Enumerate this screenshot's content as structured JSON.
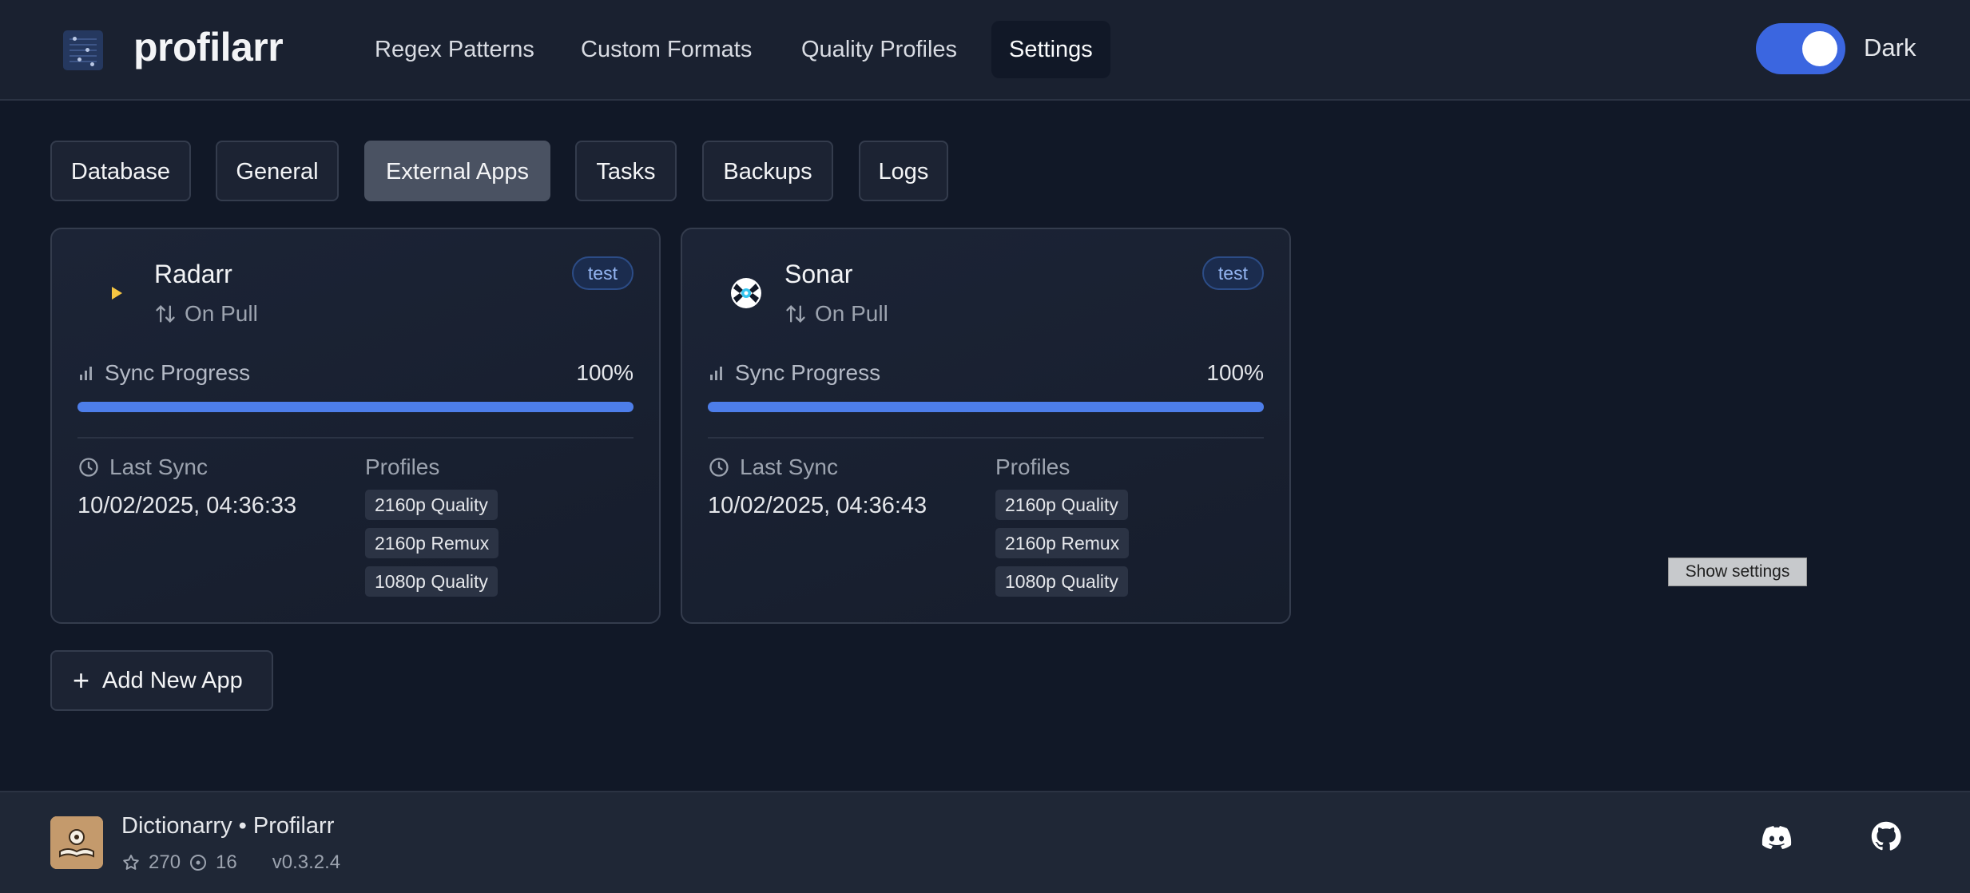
{
  "header": {
    "brand": "profilarr",
    "nav": [
      {
        "label": "Regex Patterns"
      },
      {
        "label": "Custom Formats"
      },
      {
        "label": "Quality Profiles"
      },
      {
        "label": "Settings"
      }
    ],
    "theme_label": "Dark",
    "theme_on": true
  },
  "tabs": [
    {
      "label": "Database"
    },
    {
      "label": "General"
    },
    {
      "label": "External Apps"
    },
    {
      "label": "Tasks"
    },
    {
      "label": "Backups"
    },
    {
      "label": "Logs"
    }
  ],
  "active_tab": "External Apps",
  "apps": [
    {
      "name": "Radarr",
      "tag": "test",
      "sync_method": "On Pull",
      "progress_label": "Sync Progress",
      "progress": 100,
      "progress_text": "100%",
      "last_sync_label": "Last Sync",
      "last_sync": "10/02/2025, 04:36:33",
      "profiles_label": "Profiles",
      "profiles": [
        "2160p Quality",
        "2160p Remux",
        "1080p Quality"
      ]
    },
    {
      "name": "Sonar",
      "tag": "test",
      "sync_method": "On Pull",
      "progress_label": "Sync Progress",
      "progress": 100,
      "progress_text": "100%",
      "last_sync_label": "Last Sync",
      "last_sync": "10/02/2025, 04:36:43",
      "profiles_label": "Profiles",
      "profiles": [
        "2160p Quality",
        "2160p Remux",
        "1080p Quality"
      ]
    }
  ],
  "add_app_label": "Add New App",
  "show_settings_label": "Show settings",
  "footer": {
    "repo": "Dictionarry • Profilarr",
    "stars": "270",
    "issues": "16",
    "version": "v0.3.2.4"
  },
  "colors": {
    "accent": "#4d7eea",
    "background": "#111827",
    "tag": "#93b4f0"
  },
  "icons": {
    "theme": "toggle-switch",
    "sync_method": "arrows-up-down-icon",
    "progress": "signal-bars-icon",
    "last_sync": "clock-icon",
    "add": "plus-icon",
    "stars": "star-icon",
    "issues": "issue-circle-icon",
    "discord": "discord-icon",
    "github": "github-icon"
  }
}
